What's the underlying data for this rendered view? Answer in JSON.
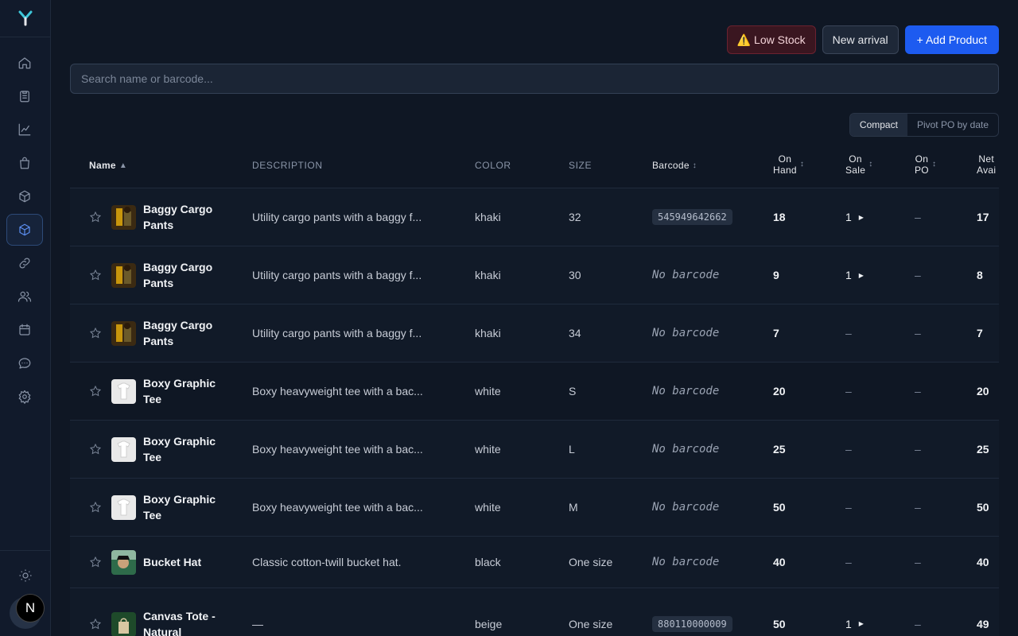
{
  "sidebar": {
    "logo": "Y",
    "items": [
      {
        "icon": "home-icon"
      },
      {
        "icon": "clipboard-icon"
      },
      {
        "icon": "chart-line-icon"
      },
      {
        "icon": "shopping-bag-icon"
      },
      {
        "icon": "box-icon"
      },
      {
        "icon": "box-active-icon",
        "active": true
      },
      {
        "icon": "link-icon"
      },
      {
        "icon": "users-icon"
      },
      {
        "icon": "calendar-icon"
      },
      {
        "icon": "chat-icon"
      },
      {
        "icon": "settings-icon"
      }
    ],
    "avatar_initial": "N"
  },
  "toolbar": {
    "low_stock_label": "⚠️ Low Stock",
    "new_arrival_label": "New arrival",
    "add_product_label": "+ Add Product"
  },
  "search": {
    "placeholder": "Search name or barcode..."
  },
  "view_toggle": {
    "compact": "Compact",
    "pivot": "Pivot PO by date"
  },
  "columns": {
    "name": "Name",
    "description": "DESCRIPTION",
    "color": "COLOR",
    "size": "SIZE",
    "barcode": "Barcode",
    "on_hand_1": "On",
    "on_hand_2": "Hand",
    "on_sale_1": "On",
    "on_sale_2": "Sale",
    "on_po_1": "On",
    "on_po_2": "PO",
    "net_1": "Net",
    "net_2": "Avai"
  },
  "rows": [
    {
      "name": "Baggy Cargo Pants",
      "description": "Utility cargo pants with a baggy f...",
      "color": "khaki",
      "size": "32",
      "barcode": "545949642662",
      "on_hand": "18",
      "on_sale": "1",
      "on_po": "–",
      "net": "17"
    },
    {
      "name": "Baggy Cargo Pants",
      "description": "Utility cargo pants with a baggy f...",
      "color": "khaki",
      "size": "30",
      "barcode": "No barcode",
      "on_hand": "9",
      "on_sale": "1",
      "on_po": "–",
      "net": "8"
    },
    {
      "name": "Baggy Cargo Pants",
      "description": "Utility cargo pants with a baggy f...",
      "color": "khaki",
      "size": "34",
      "barcode": "No barcode",
      "on_hand": "7",
      "on_sale": "–",
      "on_po": "–",
      "net": "7"
    },
    {
      "name": "Boxy Graphic Tee",
      "description": "Boxy heavyweight tee with a bac...",
      "color": "white",
      "size": "S",
      "barcode": "No barcode",
      "on_hand": "20",
      "on_sale": "–",
      "on_po": "–",
      "net": "20"
    },
    {
      "name": "Boxy Graphic Tee",
      "description": "Boxy heavyweight tee with a bac...",
      "color": "white",
      "size": "L",
      "barcode": "No barcode",
      "on_hand": "25",
      "on_sale": "–",
      "on_po": "–",
      "net": "25"
    },
    {
      "name": "Boxy Graphic Tee",
      "description": "Boxy heavyweight tee with a bac...",
      "color": "white",
      "size": "M",
      "barcode": "No barcode",
      "on_hand": "50",
      "on_sale": "–",
      "on_po": "–",
      "net": "50"
    },
    {
      "name": "Bucket Hat",
      "description": "Classic cotton-twill bucket hat.",
      "color": "black",
      "size": "One size",
      "barcode": "No barcode",
      "on_hand": "40",
      "on_sale": "–",
      "on_po": "–",
      "net": "40"
    },
    {
      "name": "Canvas Tote - Natural",
      "description": "—",
      "color": "beige",
      "size": "One size",
      "barcode": "880110000009",
      "on_hand": "50",
      "on_sale": "1",
      "on_po": "–",
      "net": "49"
    }
  ]
}
